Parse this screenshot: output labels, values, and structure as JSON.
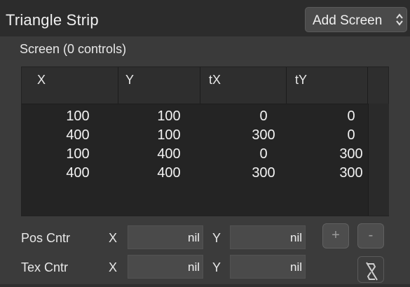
{
  "header": {
    "title": "Triangle Strip",
    "add_screen_label": "Add Screen",
    "add_screen_icon": "chevron-updown-icon"
  },
  "subheader": {
    "screen_label": "Screen (0 controls)"
  },
  "table": {
    "columns": [
      "X",
      "Y",
      "tX",
      "tY"
    ],
    "rows": [
      [
        "100",
        "100",
        "0",
        "0"
      ],
      [
        "400",
        "100",
        "300",
        "0"
      ],
      [
        "100",
        "400",
        "0",
        "300"
      ],
      [
        "400",
        "400",
        "300",
        "300"
      ]
    ]
  },
  "pos_center": {
    "label": "Pos Cntr",
    "x_label": "X",
    "x_value": "nil",
    "y_label": "Y",
    "y_value": "nil"
  },
  "tex_center": {
    "label": "Tex Cntr",
    "x_label": "X",
    "x_value": "nil",
    "y_label": "Y",
    "y_value": "nil"
  },
  "buttons": {
    "add_label": "+",
    "remove_label": "-",
    "unlink_icon": "broken-link-icon"
  }
}
